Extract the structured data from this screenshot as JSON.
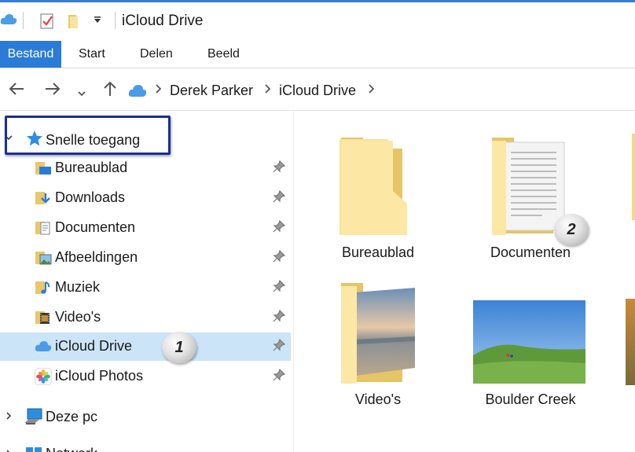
{
  "window": {
    "title": "iCloud Drive",
    "quick_access_icons": [
      "icloud-icon",
      "properties-checkmark-icon",
      "new-folder-icon",
      "dropdown-arrow-icon"
    ]
  },
  "ribbon": {
    "tabs": [
      {
        "label": "Bestand",
        "active": true
      },
      {
        "label": "Start"
      },
      {
        "label": "Delen"
      },
      {
        "label": "Beeld"
      }
    ],
    "accent_color": "#2b7bd9"
  },
  "address_bar": {
    "breadcrumbs": [
      "Derek Parker",
      "iCloud Drive"
    ]
  },
  "sidebar": {
    "quick_access_label": "Snelle toegang",
    "items": [
      {
        "label": "Bureaublad",
        "icon": "desktop-folder-icon",
        "pinned": true
      },
      {
        "label": "Downloads",
        "icon": "downloads-folder-icon",
        "pinned": true
      },
      {
        "label": "Documenten",
        "icon": "documents-folder-icon",
        "pinned": true
      },
      {
        "label": "Afbeeldingen",
        "icon": "pictures-folder-icon",
        "pinned": true
      },
      {
        "label": "Muziek",
        "icon": "music-folder-icon",
        "pinned": true
      },
      {
        "label": "Video's",
        "icon": "videos-folder-icon",
        "pinned": true
      },
      {
        "label": "iCloud Drive",
        "icon": "icloud-drive-icon",
        "pinned": true,
        "selected": true
      },
      {
        "label": "iCloud Photos",
        "icon": "icloud-photos-icon",
        "pinned": true
      }
    ],
    "this_pc_label": "Deze pc",
    "network_label": "Netwerk"
  },
  "content": {
    "tiles": [
      {
        "label": "Bureaublad",
        "kind": "folder"
      },
      {
        "label": "Documenten",
        "kind": "folder-with-document"
      },
      {
        "label": "Video's",
        "kind": "folder-with-photo"
      },
      {
        "label": "Boulder Creek",
        "kind": "photo"
      }
    ]
  },
  "callouts": {
    "badge_1": "1",
    "badge_2": "2",
    "highlight_color": "#1a2e9a"
  }
}
